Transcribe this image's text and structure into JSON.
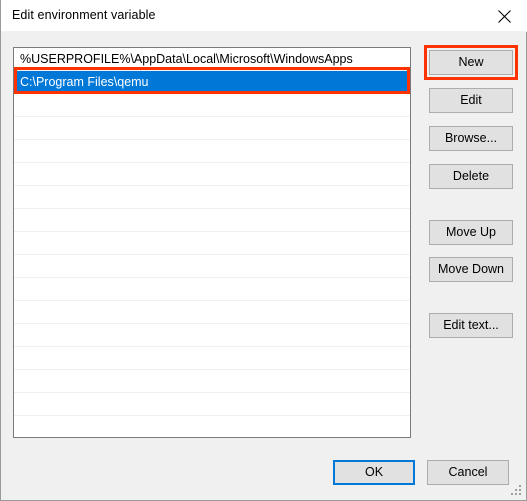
{
  "window": {
    "title": "Edit environment variable",
    "close_icon": "close-icon"
  },
  "listbox": {
    "entries": [
      "%USERPROFILE%\\AppData\\Local\\Microsoft\\WindowsApps",
      "C:\\Program Files\\qemu"
    ],
    "selected_index": 1,
    "empty_rows": 15
  },
  "side_buttons": [
    {
      "id": "new",
      "label": "New"
    },
    {
      "id": "edit",
      "label": "Edit"
    },
    {
      "id": "browse",
      "label": "Browse..."
    },
    {
      "id": "delete",
      "label": "Delete"
    },
    {
      "id": "move-up",
      "label": "Move Up"
    },
    {
      "id": "move-down",
      "label": "Move Down"
    },
    {
      "id": "edit-text",
      "label": "Edit text..."
    }
  ],
  "footer": {
    "ok_label": "OK",
    "cancel_label": "Cancel"
  },
  "colors": {
    "dialog_background": "#f0f0f0",
    "titlebar_background": "#ffffff",
    "listbox_background": "#ffffff",
    "selection_background": "#0078d7",
    "selection_text": "#ffffff",
    "button_face": "#e1e1e1",
    "button_border": "#adadad",
    "focus_border": "#0078d7",
    "annotation": "#ff3300"
  }
}
